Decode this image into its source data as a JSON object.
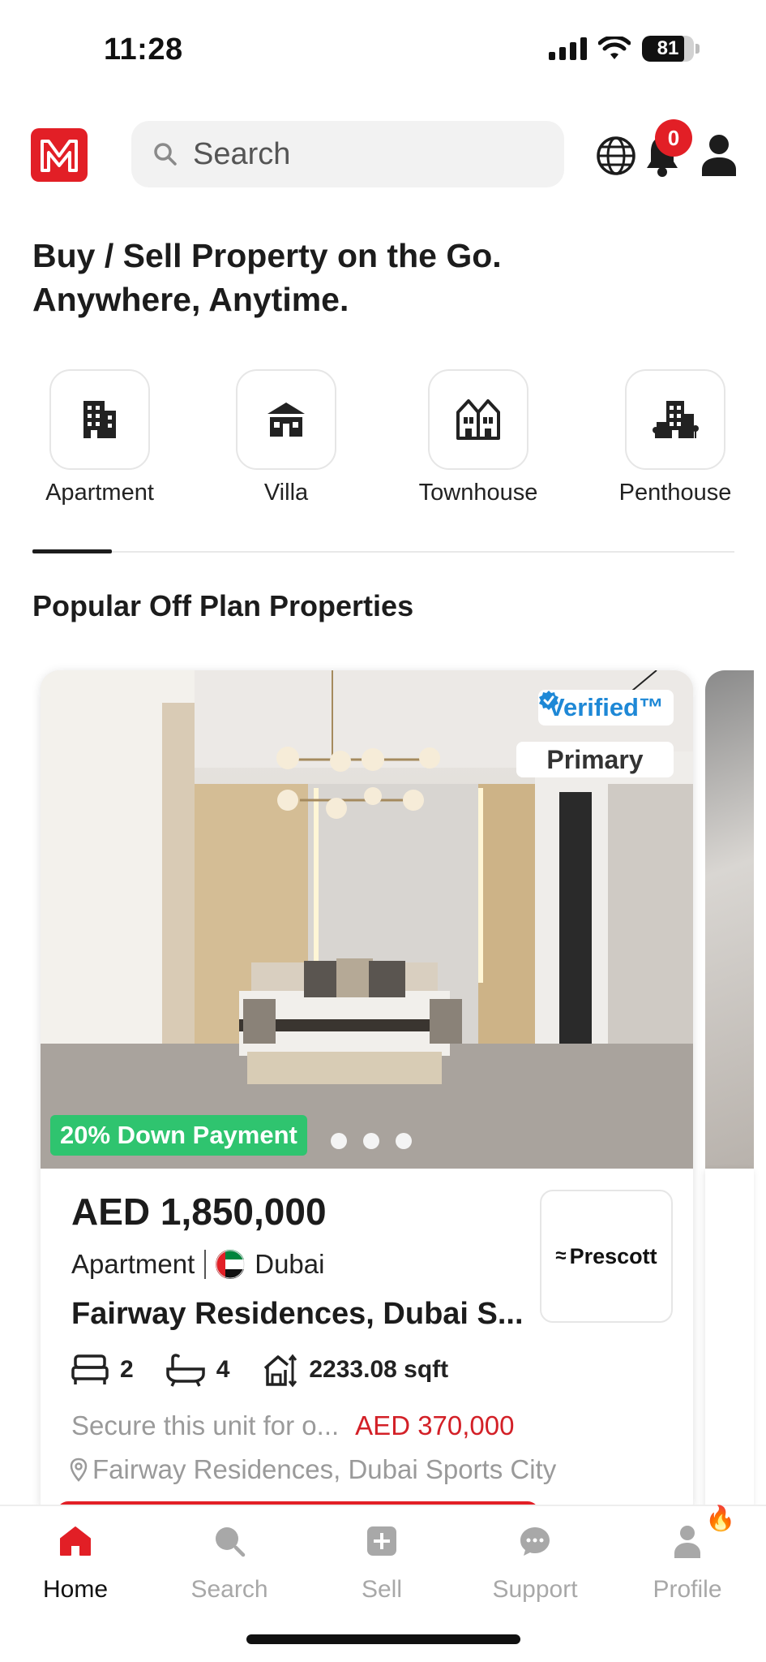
{
  "status_bar": {
    "time": "11:28",
    "battery": "81"
  },
  "header": {
    "logo_alt": "M",
    "search": {
      "placeholder": "Search"
    },
    "notifications_count": "0"
  },
  "headline": {
    "line1": "Buy / Sell Property on the Go.",
    "line2": "Anywhere, Anytime."
  },
  "categories": [
    {
      "label": "Apartment",
      "icon": "apartment-building-icon"
    },
    {
      "label": "Villa",
      "icon": "villa-icon"
    },
    {
      "label": "Townhouse",
      "icon": "townhouse-icon"
    },
    {
      "label": "Penthouse",
      "icon": "penthouse-icon"
    }
  ],
  "section_title": "Popular Off Plan Properties",
  "listing": {
    "verified_label": "Verified™",
    "market_badge": "Primary",
    "down_payment_badge": "20% Down Payment",
    "image_dots": 3,
    "price": "AED 1,850,000",
    "type": "Apartment",
    "city": "Dubai",
    "name": "Fairway Residences, Dubai S...",
    "developer": "Prescott",
    "bedrooms": "2",
    "bathrooms": "4",
    "area": "2233.08 sqft",
    "secure_text": "Secure this unit for o...",
    "secure_amount": "AED 370,000",
    "location": "Fairway Residences, Dubai Sports City"
  },
  "bottom_nav": [
    {
      "label": "Home",
      "icon": "home-icon",
      "active": true
    },
    {
      "label": "Search",
      "icon": "search-icon",
      "active": false
    },
    {
      "label": "Sell",
      "icon": "plus-square-icon",
      "active": false
    },
    {
      "label": "Support",
      "icon": "chat-bubble-icon",
      "active": false
    },
    {
      "label": "Profile",
      "icon": "user-icon",
      "active": false
    }
  ],
  "colors": {
    "brand_red": "#e21f26",
    "verified_blue": "#1e88d6",
    "down_payment_green": "#2fc46f"
  }
}
